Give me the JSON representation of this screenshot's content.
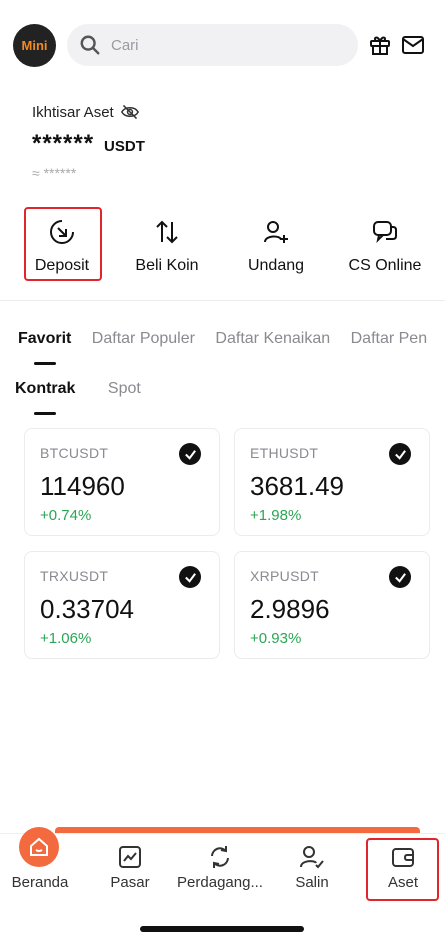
{
  "header": {
    "logo_text": "Mini",
    "search_placeholder": "Cari"
  },
  "overview": {
    "label": "Ikhtisar Aset",
    "balance_masked": "******",
    "unit": "USDT",
    "approx": "≈ ******"
  },
  "actions": [
    {
      "label": "Deposit",
      "icon": "deposit-icon"
    },
    {
      "label": "Beli Koin",
      "icon": "buy-arrows-icon"
    },
    {
      "label": "Undang",
      "icon": "invite-user-icon"
    },
    {
      "label": "CS Online",
      "icon": "chat-icon"
    }
  ],
  "tabs_primary": [
    "Favorit",
    "Daftar Populer",
    "Daftar Kenaikan",
    "Daftar Pen"
  ],
  "tabs_secondary": [
    "Kontrak",
    "Spot"
  ],
  "cards": [
    {
      "pair": "BTCUSDT",
      "price": "114960",
      "change": "+0.74%"
    },
    {
      "pair": "ETHUSDT",
      "price": "3681.49",
      "change": "+1.98%"
    },
    {
      "pair": "TRXUSDT",
      "price": "0.33704",
      "change": "+1.06%"
    },
    {
      "pair": "XRPUSDT",
      "price": "2.9896",
      "change": "+0.93%"
    }
  ],
  "bottom_nav": [
    {
      "label": "Beranda",
      "icon": "home-icon"
    },
    {
      "label": "Pasar",
      "icon": "market-chart-icon"
    },
    {
      "label": "Perdagang...",
      "icon": "trade-swap-icon"
    },
    {
      "label": "Salin",
      "icon": "copy-user-icon"
    },
    {
      "label": "Aset",
      "icon": "wallet-icon"
    }
  ],
  "colors": {
    "accent": "#f26a3e",
    "positive": "#2aa655",
    "highlight_border": "#e0252b"
  }
}
